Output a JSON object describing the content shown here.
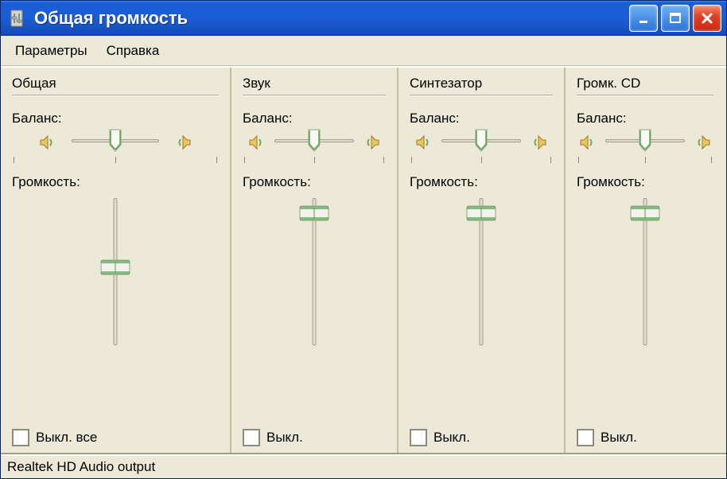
{
  "window": {
    "title": "Общая громкость"
  },
  "menu": {
    "parameters": "Параметры",
    "help": "Справка"
  },
  "labels": {
    "balance": "Баланс:",
    "volume": "Громкость:"
  },
  "channels": [
    {
      "name": "Общая",
      "balance": 50,
      "volume": 55,
      "mute_label": "Выкл. все",
      "muted": false
    },
    {
      "name": "Звук",
      "balance": 50,
      "volume": 95,
      "mute_label": "Выкл.",
      "muted": false
    },
    {
      "name": "Синтезатор",
      "balance": 50,
      "volume": 95,
      "mute_label": "Выкл.",
      "muted": false
    },
    {
      "name": "Громк. CD",
      "balance": 50,
      "volume": 95,
      "mute_label": "Выкл.",
      "muted": false
    }
  ],
  "status": "Realtek HD Audio output"
}
